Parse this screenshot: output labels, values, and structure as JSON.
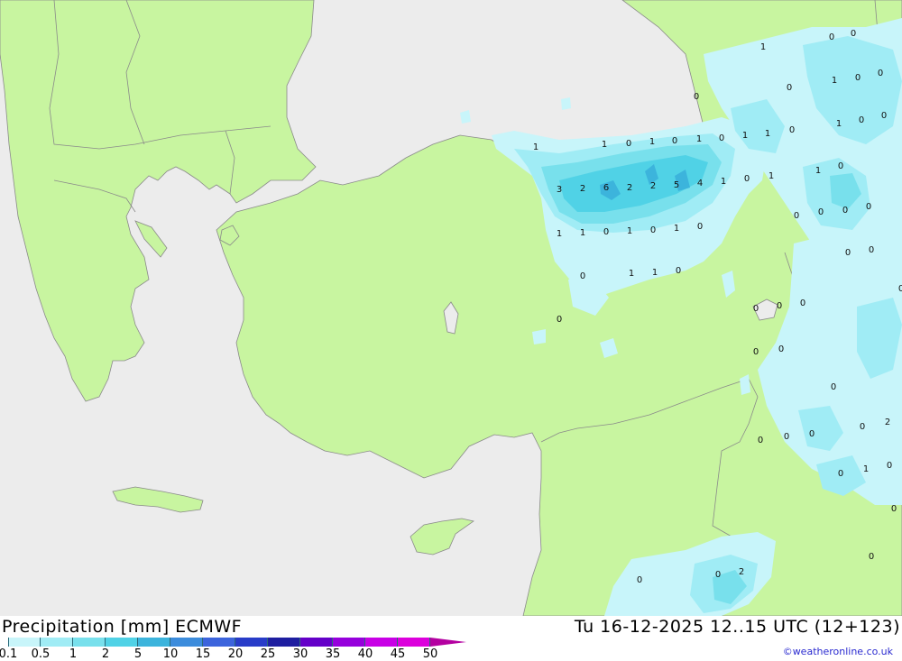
{
  "title": "Precipitation [mm] ECMWF",
  "valid_time": "Tu 16-12-2025 12..15 UTC (12+123)",
  "credit": "©weatheronline.co.uk",
  "colors": {
    "land": "#c8f5a0",
    "sea": "#ececec",
    "border": "#8a8a8a"
  },
  "legend": {
    "ticks": [
      "0.1",
      "0.5",
      "1",
      "2",
      "5",
      "10",
      "15",
      "20",
      "25",
      "30",
      "35",
      "40",
      "45",
      "50"
    ],
    "colors": [
      "#c8f5fa",
      "#a0ecf5",
      "#78e0ec",
      "#50d2e6",
      "#3cb4dc",
      "#3c8cdc",
      "#3c64dc",
      "#283cc8",
      "#1e1ea0",
      "#6400c8",
      "#9600dc",
      "#c800e6",
      "#dc00dc",
      "#b400a0"
    ]
  },
  "point_labels": [
    "1",
    "0",
    "0",
    "0",
    "0",
    "1",
    "0",
    "0",
    "1",
    "0",
    "0",
    "0",
    "1",
    "1",
    "0",
    "1",
    "0",
    "1",
    "0",
    "1",
    "1",
    "1",
    "0",
    "1",
    "0",
    "3",
    "2",
    "6",
    "2",
    "2",
    "5",
    "4",
    "1",
    "0",
    "0",
    "0",
    "0",
    "1",
    "1",
    "0",
    "1",
    "0",
    "1",
    "0",
    "0",
    "0",
    "0",
    "1",
    "1",
    "0",
    "0",
    "0",
    "0",
    "0",
    "0",
    "0",
    "0",
    "0",
    "0",
    "0",
    "0",
    "0",
    "2",
    "0",
    "1",
    "0",
    "0",
    "0",
    "0",
    "2",
    "0"
  ]
}
